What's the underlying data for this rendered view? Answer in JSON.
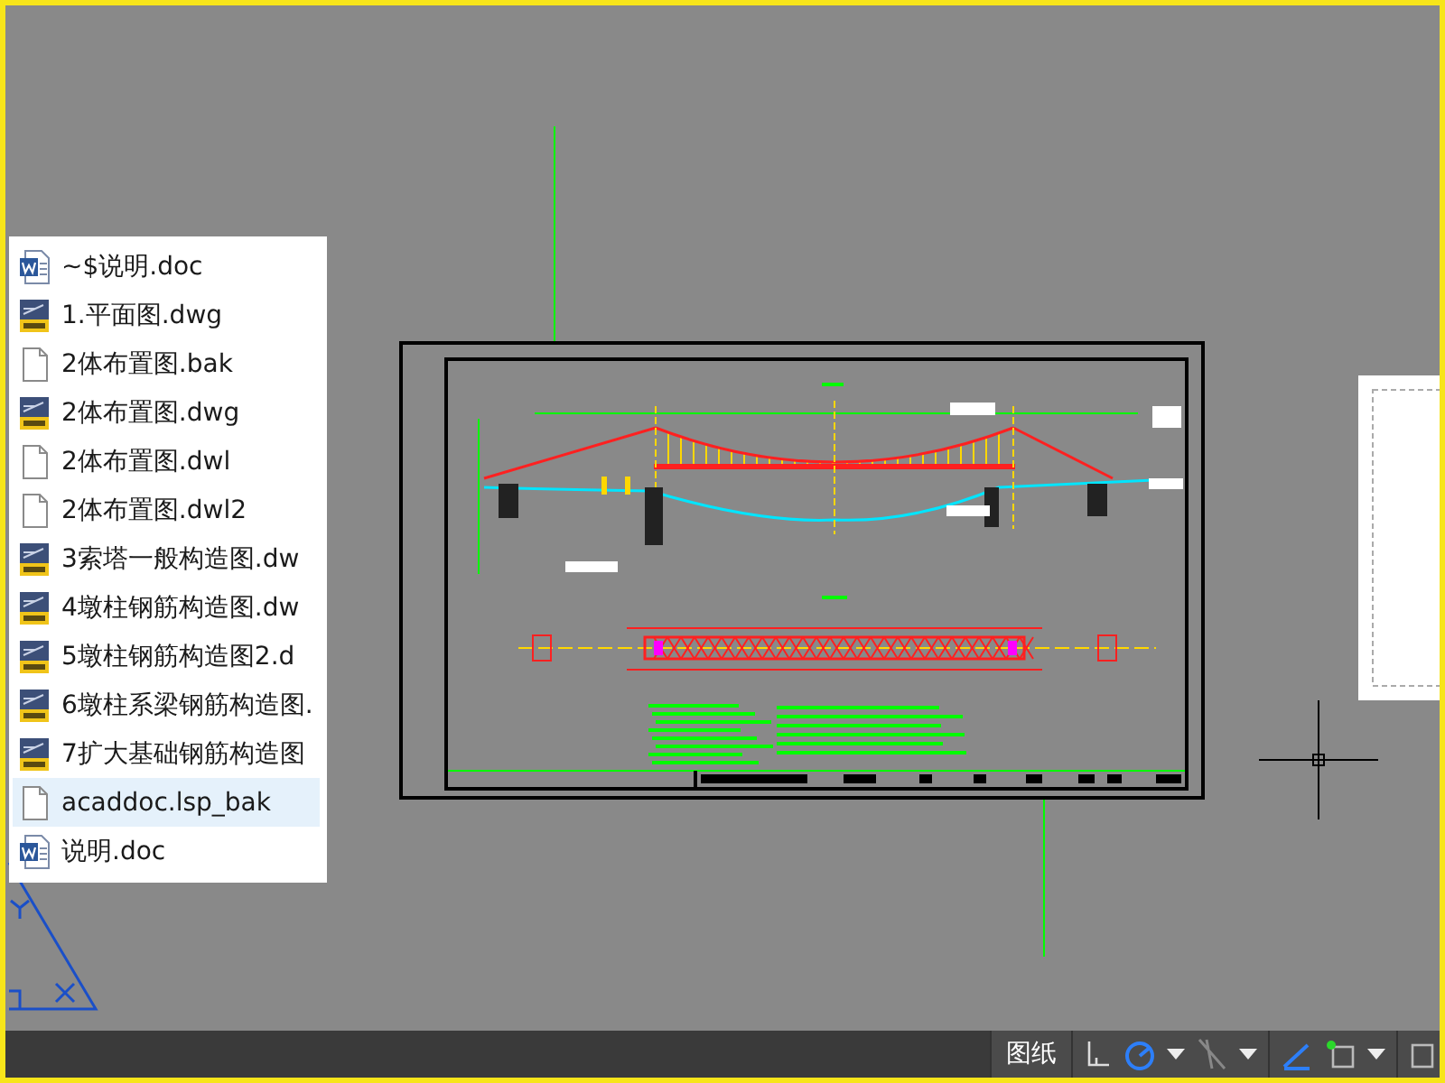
{
  "files": [
    {
      "name": "~$说明.doc",
      "kind": "word",
      "selected": false
    },
    {
      "name": "1.平面图.dwg",
      "kind": "dwg",
      "selected": false
    },
    {
      "name": "2体布置图.bak",
      "kind": "blank",
      "selected": false
    },
    {
      "name": "2体布置图.dwg",
      "kind": "dwg",
      "selected": false
    },
    {
      "name": "2体布置图.dwl",
      "kind": "blank",
      "selected": false
    },
    {
      "name": "2体布置图.dwl2",
      "kind": "blank",
      "selected": false
    },
    {
      "name": "3索塔一般构造图.dw",
      "kind": "dwg",
      "selected": false
    },
    {
      "name": "4墩柱钢筋构造图.dw",
      "kind": "dwg",
      "selected": false
    },
    {
      "name": "5墩柱钢筋构造图2.d",
      "kind": "dwg",
      "selected": false
    },
    {
      "name": "6墩柱系梁钢筋构造图.",
      "kind": "dwg",
      "selected": false
    },
    {
      "name": "7扩大基础钢筋构造图",
      "kind": "dwg",
      "selected": false
    },
    {
      "name": "acaddoc.lsp_bak",
      "kind": "blank",
      "selected": true
    },
    {
      "name": "说明.doc",
      "kind": "word",
      "selected": false
    }
  ],
  "status_bar": {
    "space_button": "图纸"
  }
}
